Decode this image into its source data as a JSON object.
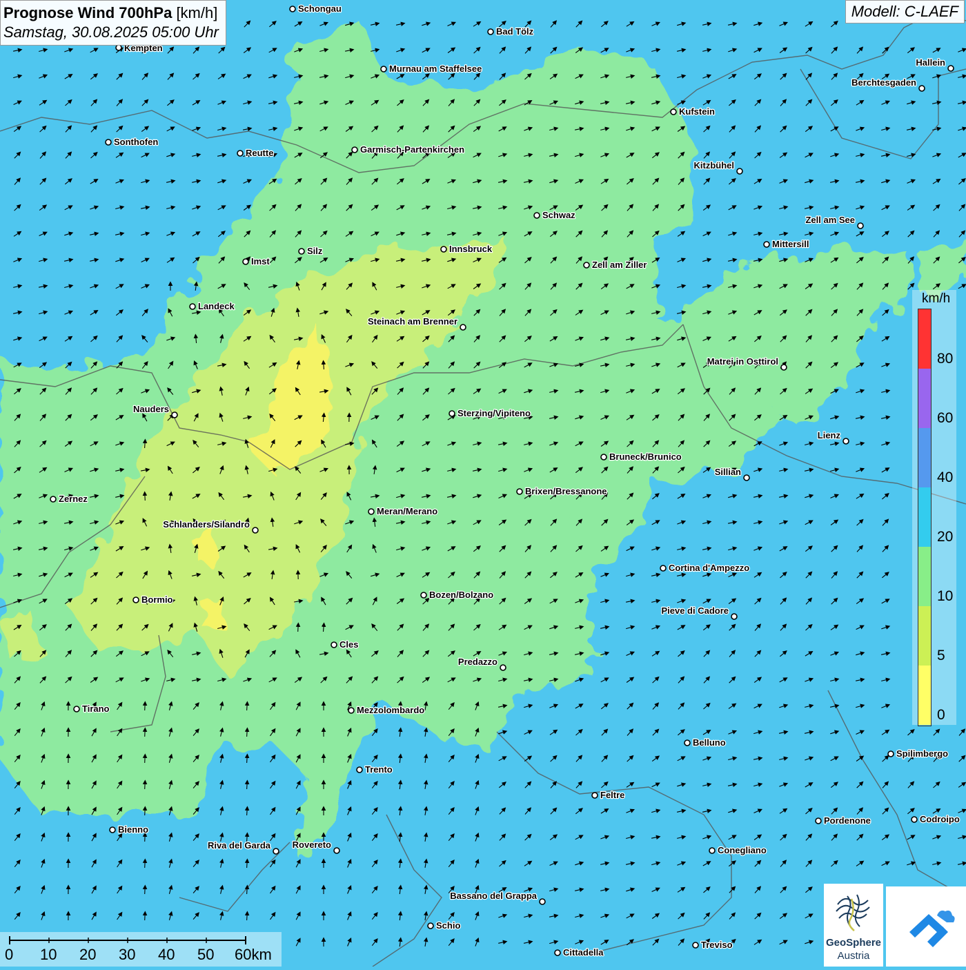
{
  "header": {
    "title": "Prognose Wind 700hPa",
    "unit": "[km/h]",
    "date": "Samstag, 30.08.2025 05:00 Uhr"
  },
  "model": "Modell: C-LAEF",
  "legend": {
    "title": "km/h",
    "labels": [
      "80",
      "60",
      "40",
      "20",
      "10",
      "5",
      "0"
    ],
    "colors": [
      "#ff3333",
      "#9966ee",
      "#5599ee",
      "#33ccee",
      "#88ee88",
      "#ccf055",
      "#ffff66"
    ]
  },
  "scalebar": {
    "labels": [
      "0",
      "10",
      "20",
      "30",
      "40",
      "50",
      "60km"
    ]
  },
  "logos": {
    "geosphere_line1": "GeoSphere",
    "geosphere_line2": "Austria"
  },
  "colors": {
    "background": "#4fc6ef",
    "wind_10_20": "#8eeaa0",
    "wind_5_10": "#c8ef7a",
    "wind_0_5": "#f4f366",
    "borders": "#555555",
    "arrows": "#000000"
  },
  "cities": [
    {
      "name": "Schongau"
    },
    {
      "name": "Bad Tölz"
    },
    {
      "name": "Kempten"
    },
    {
      "name": "Murnau am Staffelsee"
    },
    {
      "name": "Hallein"
    },
    {
      "name": "Berchtesgaden"
    },
    {
      "name": "Kufstein"
    },
    {
      "name": "Sonthofen"
    },
    {
      "name": "Reutte"
    },
    {
      "name": "Garmisch-Partenkirchen"
    },
    {
      "name": "Kitzbühel"
    },
    {
      "name": "Schwaz"
    },
    {
      "name": "Zell am See"
    },
    {
      "name": "Mittersill"
    },
    {
      "name": "Silz"
    },
    {
      "name": "Innsbruck"
    },
    {
      "name": "Imst"
    },
    {
      "name": "Zell am Ziller"
    },
    {
      "name": "Landeck"
    },
    {
      "name": "Steinach am Brenner"
    },
    {
      "name": "Matrei in Osttirol"
    },
    {
      "name": "Nauders"
    },
    {
      "name": "Sterzing/Vipiteno"
    },
    {
      "name": "Lienz"
    },
    {
      "name": "Bruneck/Brunico"
    },
    {
      "name": "Sillian"
    },
    {
      "name": "Brixen/Bressanone"
    },
    {
      "name": "Zernez"
    },
    {
      "name": "Meran/Merano"
    },
    {
      "name": "Schlanders/Silandro"
    },
    {
      "name": "Cortina d'Ampezzo"
    },
    {
      "name": "Bozen/Bolzano"
    },
    {
      "name": "Bormio"
    },
    {
      "name": "Pieve di Cadore"
    },
    {
      "name": "Cles"
    },
    {
      "name": "Predazzo"
    },
    {
      "name": "Tirano"
    },
    {
      "name": "Mezzolombardo"
    },
    {
      "name": "Belluno"
    },
    {
      "name": "Spilimbergo"
    },
    {
      "name": "Trento"
    },
    {
      "name": "Feltre"
    },
    {
      "name": "Pordenone"
    },
    {
      "name": "Codroipo"
    },
    {
      "name": "Bienno"
    },
    {
      "name": "Riva del Garda"
    },
    {
      "name": "Rovereto"
    },
    {
      "name": "Conegliano"
    },
    {
      "name": "Bassano del Grappa"
    },
    {
      "name": "Schio"
    },
    {
      "name": "Treviso"
    },
    {
      "name": "Cittadella"
    }
  ]
}
